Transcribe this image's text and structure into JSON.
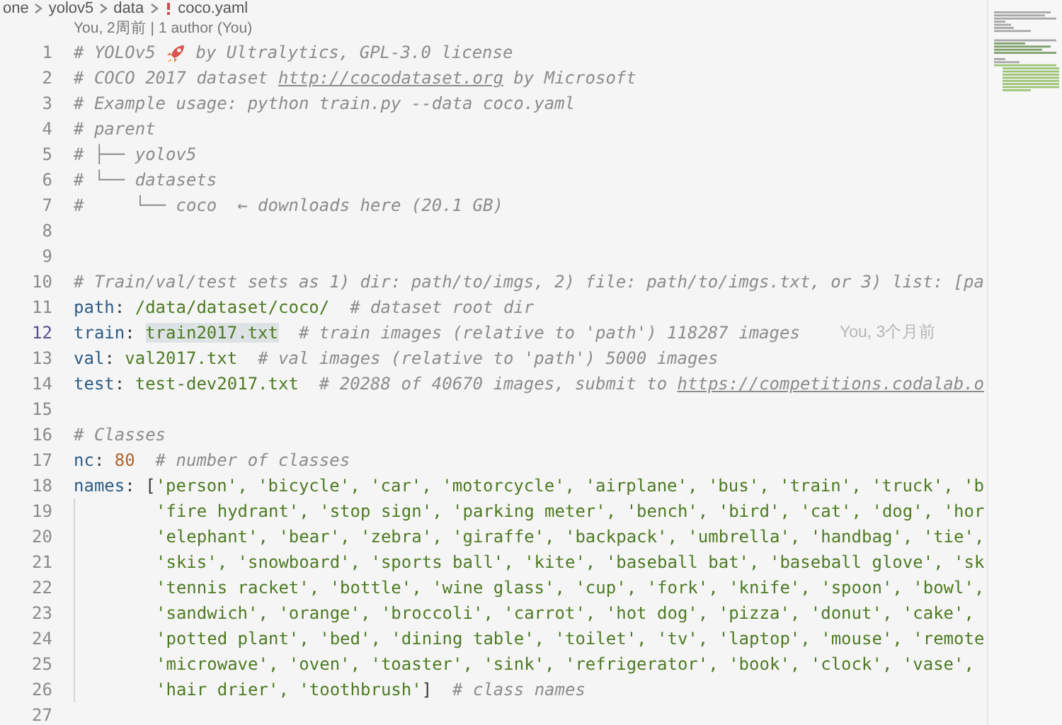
{
  "breadcrumb": [
    {
      "label": "one",
      "kind": "folder"
    },
    {
      "label": "yolov5",
      "kind": "folder"
    },
    {
      "label": "data",
      "kind": "folder"
    },
    {
      "label": "coco.yaml",
      "kind": "file"
    }
  ],
  "codelens": "You, 2周前 | 1 author (You)",
  "lines": [
    {
      "number": "1",
      "tokens": [
        {
          "t": "# YOLOv5 ",
          "kind": "comment"
        },
        {
          "kind": "icon"
        },
        {
          "t": " by Ultralytics, GPL-3.0 license",
          "kind": "comment"
        }
      ]
    },
    {
      "number": "2",
      "tokens": [
        {
          "t": "# COCO 2017 dataset ",
          "kind": "comment"
        },
        {
          "t": "http://cocodataset.org",
          "kind": "link"
        },
        {
          "t": " by Microsoft",
          "kind": "comment"
        }
      ]
    },
    {
      "number": "3",
      "tokens": [
        {
          "t": "# Example usage: python train.py --data coco.yaml",
          "kind": "comment"
        }
      ]
    },
    {
      "number": "4",
      "tokens": [
        {
          "t": "# parent",
          "kind": "comment"
        }
      ]
    },
    {
      "number": "5",
      "tokens": [
        {
          "t": "# ├── yolov5",
          "kind": "comment"
        }
      ]
    },
    {
      "number": "6",
      "tokens": [
        {
          "t": "# └── datasets",
          "kind": "comment"
        }
      ]
    },
    {
      "number": "7",
      "tokens": [
        {
          "t": "#     └── coco  ← downloads here (20.1 GB)",
          "kind": "comment"
        }
      ]
    },
    {
      "number": "8"
    },
    {
      "number": "9"
    },
    {
      "number": "10",
      "tokens": [
        {
          "t": "# Train/val/test sets as 1) dir: path/to/imgs, 2) file: path/to/imgs.txt, or 3) list: [pa",
          "kind": "comment"
        }
      ]
    },
    {
      "number": "11",
      "tokens": [
        {
          "t": "path",
          "kind": "key"
        },
        {
          "t": ": ",
          "kind": "punct"
        },
        {
          "t": "/data/dataset/coco/",
          "kind": "string"
        },
        {
          "t": "  # dataset root dir",
          "kind": "comment"
        }
      ]
    },
    {
      "number": "12",
      "current": true,
      "blame": "You, 3个月前",
      "tokens": [
        {
          "t": "train",
          "kind": "key"
        },
        {
          "t": ": ",
          "kind": "punct"
        },
        {
          "t": "train2017.txt",
          "kind": "string",
          "highlighted": true
        },
        {
          "t": "  # train images (relative to 'path') 118287 images",
          "kind": "comment"
        }
      ]
    },
    {
      "number": "13",
      "tokens": [
        {
          "t": "val",
          "kind": "key"
        },
        {
          "t": ": ",
          "kind": "punct"
        },
        {
          "t": "val2017.txt",
          "kind": "string"
        },
        {
          "t": "  # val images (relative to 'path') 5000 images",
          "kind": "comment"
        }
      ]
    },
    {
      "number": "14",
      "tokens": [
        {
          "t": "test",
          "kind": "key"
        },
        {
          "t": ": ",
          "kind": "punct"
        },
        {
          "t": "test-dev2017.txt",
          "kind": "string"
        },
        {
          "t": "  # 20288 of 40670 images, submit to ",
          "kind": "comment"
        },
        {
          "t": "https://competitions.codalab.o",
          "kind": "link"
        }
      ]
    },
    {
      "number": "15"
    },
    {
      "number": "16",
      "tokens": [
        {
          "t": "# Classes",
          "kind": "comment"
        }
      ]
    },
    {
      "number": "17",
      "tokens": [
        {
          "t": "nc",
          "kind": "key"
        },
        {
          "t": ": ",
          "kind": "punct"
        },
        {
          "t": "80",
          "kind": "number"
        },
        {
          "t": "  # number of classes",
          "kind": "comment"
        }
      ]
    },
    {
      "number": "18",
      "tokens": [
        {
          "t": "names",
          "kind": "key"
        },
        {
          "t": ": [",
          "kind": "punct"
        },
        {
          "t": "'person', 'bicycle', 'car', 'motorcycle', 'airplane', 'bus', 'train', 'truck', 'b",
          "kind": "string"
        }
      ]
    },
    {
      "number": "19",
      "continuation": true,
      "tokens": [
        {
          "t": "'fire hydrant', 'stop sign', 'parking meter', 'bench', 'bird', 'cat', 'dog', 'hor",
          "kind": "string"
        }
      ]
    },
    {
      "number": "20",
      "continuation": true,
      "tokens": [
        {
          "t": "'elephant', 'bear', 'zebra', 'giraffe', 'backpack', 'umbrella', 'handbag', 'tie',",
          "kind": "string"
        }
      ]
    },
    {
      "number": "21",
      "continuation": true,
      "tokens": [
        {
          "t": "'skis', 'snowboard', 'sports ball', 'kite', 'baseball bat', 'baseball glove', 'sk",
          "kind": "string"
        }
      ]
    },
    {
      "number": "22",
      "continuation": true,
      "tokens": [
        {
          "t": "'tennis racket', 'bottle', 'wine glass', 'cup', 'fork', 'knife', 'spoon', 'bowl',",
          "kind": "string"
        }
      ]
    },
    {
      "number": "23",
      "continuation": true,
      "tokens": [
        {
          "t": "'sandwich', 'orange', 'broccoli', 'carrot', 'hot dog', 'pizza', 'donut', 'cake',",
          "kind": "string"
        }
      ]
    },
    {
      "number": "24",
      "continuation": true,
      "tokens": [
        {
          "t": "'potted plant', 'bed', 'dining table', 'toilet', 'tv', 'laptop', 'mouse', 'remote",
          "kind": "string"
        }
      ]
    },
    {
      "number": "25",
      "continuation": true,
      "tokens": [
        {
          "t": "'microwave', 'oven', 'toaster', 'sink', 'refrigerator', 'book', 'clock', 'vase',",
          "kind": "string"
        }
      ]
    },
    {
      "number": "26",
      "continuation": true,
      "tokens": [
        {
          "t": "'hair drier', 'toothbrush'",
          "kind": "string"
        },
        {
          "t": "]",
          "kind": "punct"
        },
        {
          "t": "  # class names",
          "kind": "comment"
        }
      ]
    },
    {
      "number": "27"
    }
  ]
}
